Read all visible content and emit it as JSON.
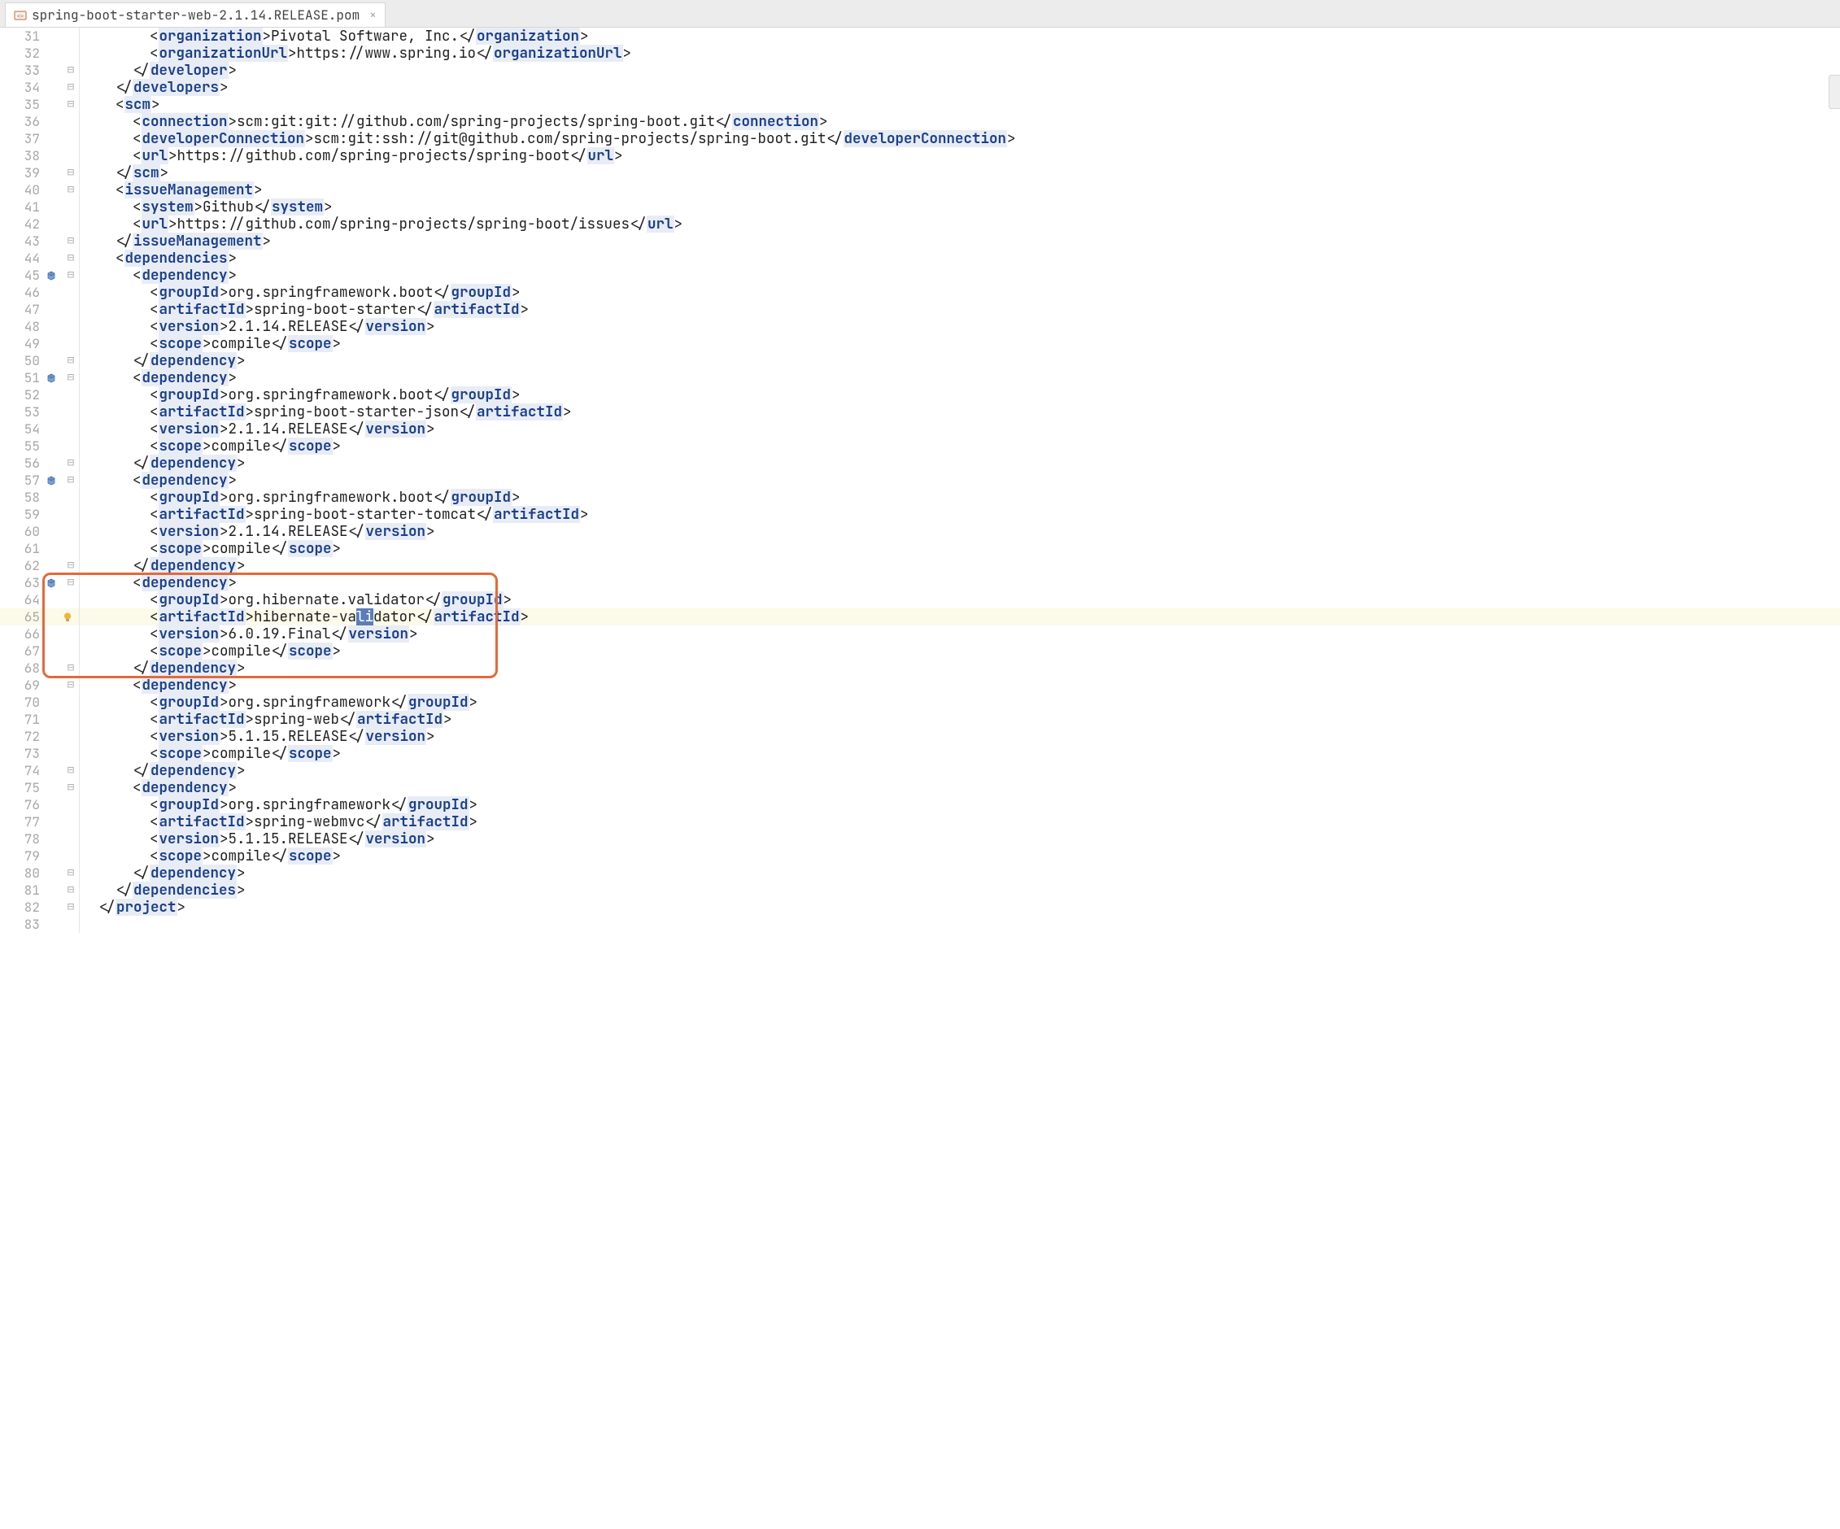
{
  "tab": {
    "filename": "spring-boot-starter-web-2.1.14.RELEASE.pom",
    "close_glyph": "×"
  },
  "lines": [
    {
      "n": 31,
      "indent": 4,
      "parts": [
        {
          "punc": "<"
        },
        {
          "tag": "organization"
        },
        {
          "punc": ">"
        },
        {
          "text": "Pivotal Software, Inc."
        },
        {
          "punc": "</"
        },
        {
          "tag": "organization"
        },
        {
          "punc": ">"
        }
      ],
      "fold": ""
    },
    {
      "n": 32,
      "indent": 4,
      "parts": [
        {
          "punc": "<"
        },
        {
          "tag": "organizationUrl"
        },
        {
          "punc": ">"
        },
        {
          "text": "https://www.spring.io"
        },
        {
          "punc": "</"
        },
        {
          "tag": "organizationUrl"
        },
        {
          "punc": ">"
        }
      ]
    },
    {
      "n": 33,
      "indent": 3,
      "parts": [
        {
          "punc": "</"
        },
        {
          "tag": "developer"
        },
        {
          "punc": ">"
        }
      ],
      "fold": "⊟"
    },
    {
      "n": 34,
      "indent": 2,
      "parts": [
        {
          "punc": "</"
        },
        {
          "tag": "developers"
        },
        {
          "punc": ">"
        }
      ],
      "fold": "⊟"
    },
    {
      "n": 35,
      "indent": 2,
      "parts": [
        {
          "punc": "<"
        },
        {
          "tag": "scm"
        },
        {
          "punc": ">"
        }
      ],
      "fold": "⊟"
    },
    {
      "n": 36,
      "indent": 3,
      "parts": [
        {
          "punc": "<"
        },
        {
          "tag": "connection"
        },
        {
          "punc": ">"
        },
        {
          "text": "scm:git:git://github.com/spring-projects/spring-boot.git"
        },
        {
          "punc": "</"
        },
        {
          "tag": "connection"
        },
        {
          "punc": ">"
        }
      ]
    },
    {
      "n": 37,
      "indent": 3,
      "parts": [
        {
          "punc": "<"
        },
        {
          "tag": "developerConnection"
        },
        {
          "punc": ">"
        },
        {
          "text": "scm:git:ssh://git@github.com/spring-projects/spring-boot.git"
        },
        {
          "punc": "</"
        },
        {
          "tag": "developerConnection"
        },
        {
          "punc": ">"
        }
      ]
    },
    {
      "n": 38,
      "indent": 3,
      "parts": [
        {
          "punc": "<"
        },
        {
          "tag": "url"
        },
        {
          "punc": ">"
        },
        {
          "text": "https://github.com/spring-projects/spring-boot"
        },
        {
          "punc": "</"
        },
        {
          "tag": "url"
        },
        {
          "punc": ">"
        }
      ]
    },
    {
      "n": 39,
      "indent": 2,
      "parts": [
        {
          "punc": "</"
        },
        {
          "tag": "scm"
        },
        {
          "punc": ">"
        }
      ],
      "fold": "⊟"
    },
    {
      "n": 40,
      "indent": 2,
      "parts": [
        {
          "punc": "<"
        },
        {
          "tag": "issueManagement"
        },
        {
          "punc": ">"
        }
      ],
      "fold": "⊟"
    },
    {
      "n": 41,
      "indent": 3,
      "parts": [
        {
          "punc": "<"
        },
        {
          "tag": "system"
        },
        {
          "punc": ">"
        },
        {
          "text": "Github"
        },
        {
          "punc": "</"
        },
        {
          "tag": "system"
        },
        {
          "punc": ">"
        }
      ]
    },
    {
      "n": 42,
      "indent": 3,
      "parts": [
        {
          "punc": "<"
        },
        {
          "tag": "url"
        },
        {
          "punc": ">"
        },
        {
          "text": "https://github.com/spring-projects/spring-boot/issues"
        },
        {
          "punc": "</"
        },
        {
          "tag": "url"
        },
        {
          "punc": ">"
        }
      ]
    },
    {
      "n": 43,
      "indent": 2,
      "parts": [
        {
          "punc": "</"
        },
        {
          "tag": "issueManagement"
        },
        {
          "punc": ">"
        }
      ],
      "fold": "⊟"
    },
    {
      "n": 44,
      "indent": 2,
      "parts": [
        {
          "punc": "<"
        },
        {
          "tag": "dependencies"
        },
        {
          "punc": ">"
        }
      ],
      "fold": "⊟"
    },
    {
      "n": 45,
      "indent": 3,
      "parts": [
        {
          "punc": "<"
        },
        {
          "tag": "dependency"
        },
        {
          "punc": ">"
        }
      ],
      "marker": "lib",
      "fold": "⊟"
    },
    {
      "n": 46,
      "indent": 4,
      "parts": [
        {
          "punc": "<"
        },
        {
          "tag": "groupId"
        },
        {
          "punc": ">"
        },
        {
          "text": "org.springframework.boot"
        },
        {
          "punc": "</"
        },
        {
          "tag": "groupId"
        },
        {
          "punc": ">"
        }
      ]
    },
    {
      "n": 47,
      "indent": 4,
      "parts": [
        {
          "punc": "<"
        },
        {
          "tag": "artifactId"
        },
        {
          "punc": ">"
        },
        {
          "text": "spring-boot-starter"
        },
        {
          "punc": "</"
        },
        {
          "tag": "artifactId"
        },
        {
          "punc": ">"
        }
      ]
    },
    {
      "n": 48,
      "indent": 4,
      "parts": [
        {
          "punc": "<"
        },
        {
          "tag": "version"
        },
        {
          "punc": ">"
        },
        {
          "text": "2.1.14.RELEASE"
        },
        {
          "punc": "</"
        },
        {
          "tag": "version"
        },
        {
          "punc": ">"
        }
      ]
    },
    {
      "n": 49,
      "indent": 4,
      "parts": [
        {
          "punc": "<"
        },
        {
          "tag": "scope"
        },
        {
          "punc": ">"
        },
        {
          "text": "compile"
        },
        {
          "punc": "</"
        },
        {
          "tag": "scope"
        },
        {
          "punc": ">"
        }
      ]
    },
    {
      "n": 50,
      "indent": 3,
      "parts": [
        {
          "punc": "</"
        },
        {
          "tag": "dependency"
        },
        {
          "punc": ">"
        }
      ],
      "fold": "⊟"
    },
    {
      "n": 51,
      "indent": 3,
      "parts": [
        {
          "punc": "<"
        },
        {
          "tag": "dependency"
        },
        {
          "punc": ">"
        }
      ],
      "marker": "lib",
      "fold": "⊟"
    },
    {
      "n": 52,
      "indent": 4,
      "parts": [
        {
          "punc": "<"
        },
        {
          "tag": "groupId"
        },
        {
          "punc": ">"
        },
        {
          "text": "org.springframework.boot"
        },
        {
          "punc": "</"
        },
        {
          "tag": "groupId"
        },
        {
          "punc": ">"
        }
      ]
    },
    {
      "n": 53,
      "indent": 4,
      "parts": [
        {
          "punc": "<"
        },
        {
          "tag": "artifactId"
        },
        {
          "punc": ">"
        },
        {
          "text": "spring-boot-starter-json"
        },
        {
          "punc": "</"
        },
        {
          "tag": "artifactId"
        },
        {
          "punc": ">"
        }
      ]
    },
    {
      "n": 54,
      "indent": 4,
      "parts": [
        {
          "punc": "<"
        },
        {
          "tag": "version"
        },
        {
          "punc": ">"
        },
        {
          "text": "2.1.14.RELEASE"
        },
        {
          "punc": "</"
        },
        {
          "tag": "version"
        },
        {
          "punc": ">"
        }
      ]
    },
    {
      "n": 55,
      "indent": 4,
      "parts": [
        {
          "punc": "<"
        },
        {
          "tag": "scope"
        },
        {
          "punc": ">"
        },
        {
          "text": "compile"
        },
        {
          "punc": "</"
        },
        {
          "tag": "scope"
        },
        {
          "punc": ">"
        }
      ]
    },
    {
      "n": 56,
      "indent": 3,
      "parts": [
        {
          "punc": "</"
        },
        {
          "tag": "dependency"
        },
        {
          "punc": ">"
        }
      ],
      "fold": "⊟"
    },
    {
      "n": 57,
      "indent": 3,
      "parts": [
        {
          "punc": "<"
        },
        {
          "tag": "dependency"
        },
        {
          "punc": ">"
        }
      ],
      "marker": "lib",
      "fold": "⊟"
    },
    {
      "n": 58,
      "indent": 4,
      "parts": [
        {
          "punc": "<"
        },
        {
          "tag": "groupId"
        },
        {
          "punc": ">"
        },
        {
          "text": "org.springframework.boot"
        },
        {
          "punc": "</"
        },
        {
          "tag": "groupId"
        },
        {
          "punc": ">"
        }
      ]
    },
    {
      "n": 59,
      "indent": 4,
      "parts": [
        {
          "punc": "<"
        },
        {
          "tag": "artifactId"
        },
        {
          "punc": ">"
        },
        {
          "text": "spring-boot-starter-tomcat"
        },
        {
          "punc": "</"
        },
        {
          "tag": "artifactId"
        },
        {
          "punc": ">"
        }
      ]
    },
    {
      "n": 60,
      "indent": 4,
      "parts": [
        {
          "punc": "<"
        },
        {
          "tag": "version"
        },
        {
          "punc": ">"
        },
        {
          "text": "2.1.14.RELEASE"
        },
        {
          "punc": "</"
        },
        {
          "tag": "version"
        },
        {
          "punc": ">"
        }
      ]
    },
    {
      "n": 61,
      "indent": 4,
      "parts": [
        {
          "punc": "<"
        },
        {
          "tag": "scope"
        },
        {
          "punc": ">"
        },
        {
          "text": "compile"
        },
        {
          "punc": "</"
        },
        {
          "tag": "scope"
        },
        {
          "punc": ">"
        }
      ]
    },
    {
      "n": 62,
      "indent": 3,
      "parts": [
        {
          "punc": "</"
        },
        {
          "tag": "dependency"
        },
        {
          "punc": ">"
        }
      ],
      "fold": "⊟"
    },
    {
      "n": 63,
      "indent": 3,
      "parts": [
        {
          "punc": "<"
        },
        {
          "tag": "dependency"
        },
        {
          "punc": ">"
        }
      ],
      "marker": "lib",
      "fold": "⊟"
    },
    {
      "n": 64,
      "indent": 4,
      "parts": [
        {
          "punc": "<"
        },
        {
          "tag": "groupId"
        },
        {
          "punc": ">"
        },
        {
          "text": "org.hibernate.validator"
        },
        {
          "punc": "</"
        },
        {
          "tag": "groupId"
        },
        {
          "punc": ">"
        }
      ]
    },
    {
      "n": 65,
      "indent": 4,
      "hl": true,
      "bulb": true,
      "parts": [
        {
          "punc": "<"
        },
        {
          "tag": "artifactId"
        },
        {
          "punc": ">"
        },
        {
          "text": "hibernate-va"
        },
        {
          "sel": "li"
        },
        {
          "text": "dator"
        },
        {
          "punc": "</"
        },
        {
          "tag": "artifactId"
        },
        {
          "punc": ">"
        }
      ]
    },
    {
      "n": 66,
      "indent": 4,
      "parts": [
        {
          "punc": "<"
        },
        {
          "tag": "version"
        },
        {
          "punc": ">"
        },
        {
          "text": "6.0.19.Final"
        },
        {
          "punc": "</"
        },
        {
          "tag": "version"
        },
        {
          "punc": ">"
        }
      ]
    },
    {
      "n": 67,
      "indent": 4,
      "parts": [
        {
          "punc": "<"
        },
        {
          "tag": "scope"
        },
        {
          "punc": ">"
        },
        {
          "text": "compile"
        },
        {
          "punc": "</"
        },
        {
          "tag": "scope"
        },
        {
          "punc": ">"
        }
      ]
    },
    {
      "n": 68,
      "indent": 3,
      "parts": [
        {
          "punc": "</"
        },
        {
          "tag": "dependency"
        },
        {
          "punc": ">"
        }
      ],
      "fold": "⊟"
    },
    {
      "n": 69,
      "indent": 3,
      "parts": [
        {
          "punc": "<"
        },
        {
          "tag": "dependency"
        },
        {
          "punc": ">"
        }
      ],
      "fold": "⊟"
    },
    {
      "n": 70,
      "indent": 4,
      "parts": [
        {
          "punc": "<"
        },
        {
          "tag": "groupId"
        },
        {
          "punc": ">"
        },
        {
          "text": "org.springframework"
        },
        {
          "punc": "</"
        },
        {
          "tag": "groupId"
        },
        {
          "punc": ">"
        }
      ]
    },
    {
      "n": 71,
      "indent": 4,
      "parts": [
        {
          "punc": "<"
        },
        {
          "tag": "artifactId"
        },
        {
          "punc": ">"
        },
        {
          "text": "spring-web"
        },
        {
          "punc": "</"
        },
        {
          "tag": "artifactId"
        },
        {
          "punc": ">"
        }
      ]
    },
    {
      "n": 72,
      "indent": 4,
      "parts": [
        {
          "punc": "<"
        },
        {
          "tag": "version"
        },
        {
          "punc": ">"
        },
        {
          "text": "5.1.15.RELEASE"
        },
        {
          "punc": "</"
        },
        {
          "tag": "version"
        },
        {
          "punc": ">"
        }
      ]
    },
    {
      "n": 73,
      "indent": 4,
      "parts": [
        {
          "punc": "<"
        },
        {
          "tag": "scope"
        },
        {
          "punc": ">"
        },
        {
          "text": "compile"
        },
        {
          "punc": "</"
        },
        {
          "tag": "scope"
        },
        {
          "punc": ">"
        }
      ]
    },
    {
      "n": 74,
      "indent": 3,
      "parts": [
        {
          "punc": "</"
        },
        {
          "tag": "dependency"
        },
        {
          "punc": ">"
        }
      ],
      "fold": "⊟"
    },
    {
      "n": 75,
      "indent": 3,
      "parts": [
        {
          "punc": "<"
        },
        {
          "tag": "dependency"
        },
        {
          "punc": ">"
        }
      ],
      "fold": "⊟"
    },
    {
      "n": 76,
      "indent": 4,
      "parts": [
        {
          "punc": "<"
        },
        {
          "tag": "groupId"
        },
        {
          "punc": ">"
        },
        {
          "text": "org.springframework"
        },
        {
          "punc": "</"
        },
        {
          "tag": "groupId"
        },
        {
          "punc": ">"
        }
      ]
    },
    {
      "n": 77,
      "indent": 4,
      "parts": [
        {
          "punc": "<"
        },
        {
          "tag": "artifactId"
        },
        {
          "punc": ">"
        },
        {
          "text": "spring-webmvc"
        },
        {
          "punc": "</"
        },
        {
          "tag": "artifactId"
        },
        {
          "punc": ">"
        }
      ]
    },
    {
      "n": 78,
      "indent": 4,
      "parts": [
        {
          "punc": "<"
        },
        {
          "tag": "version"
        },
        {
          "punc": ">"
        },
        {
          "text": "5.1.15.RELEASE"
        },
        {
          "punc": "</"
        },
        {
          "tag": "version"
        },
        {
          "punc": ">"
        }
      ]
    },
    {
      "n": 79,
      "indent": 4,
      "parts": [
        {
          "punc": "<"
        },
        {
          "tag": "scope"
        },
        {
          "punc": ">"
        },
        {
          "text": "compile"
        },
        {
          "punc": "</"
        },
        {
          "tag": "scope"
        },
        {
          "punc": ">"
        }
      ]
    },
    {
      "n": 80,
      "indent": 3,
      "parts": [
        {
          "punc": "</"
        },
        {
          "tag": "dependency"
        },
        {
          "punc": ">"
        }
      ],
      "fold": "⊟"
    },
    {
      "n": 81,
      "indent": 2,
      "parts": [
        {
          "punc": "</"
        },
        {
          "tag": "dependencies"
        },
        {
          "punc": ">"
        }
      ],
      "fold": "⊟"
    },
    {
      "n": 82,
      "indent": 1,
      "parts": [
        {
          "punc": "</"
        },
        {
          "tag": "project"
        },
        {
          "punc": ">"
        }
      ],
      "fold": "⊟"
    },
    {
      "n": 83,
      "indent": 0,
      "parts": []
    }
  ],
  "highlight_box": {
    "from_line": 63,
    "to_line": 68
  },
  "watermark": ""
}
